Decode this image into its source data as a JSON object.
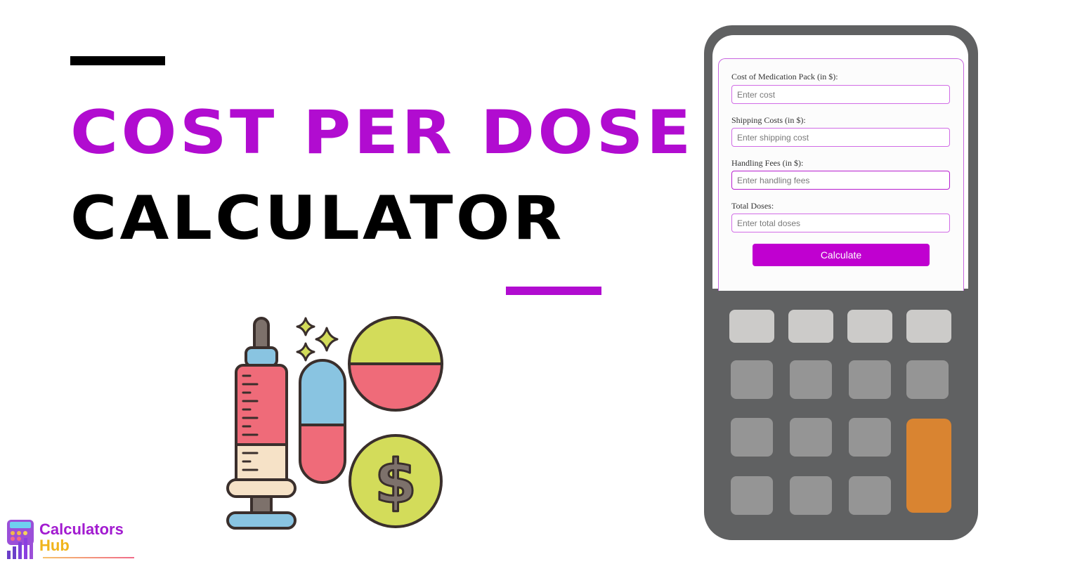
{
  "heading": {
    "line1": "COST PER DOSE",
    "line2": "CALCULATOR"
  },
  "colors": {
    "accent": "#b10cd0",
    "button": "#c000d0",
    "calculator_body": "#606162",
    "orange_key": "#d98431"
  },
  "form": {
    "fields": [
      {
        "label": "Cost of Medication Pack (in $):",
        "placeholder": "Enter cost",
        "value": ""
      },
      {
        "label": "Shipping Costs (in $):",
        "placeholder": "Enter shipping cost",
        "value": ""
      },
      {
        "label": "Handling Fees (in $):",
        "placeholder": "Enter handling fees",
        "value": ""
      },
      {
        "label": "Total Doses:",
        "placeholder": "Enter total doses",
        "value": ""
      }
    ],
    "submit_label": "Calculate"
  },
  "illustration": {
    "icons": [
      "syringe-icon",
      "capsule-icon",
      "pill-icon",
      "dollar-coin-icon",
      "sparkle-icon"
    ]
  },
  "logo": {
    "line1": "Calculators",
    "line2": "Hub"
  }
}
